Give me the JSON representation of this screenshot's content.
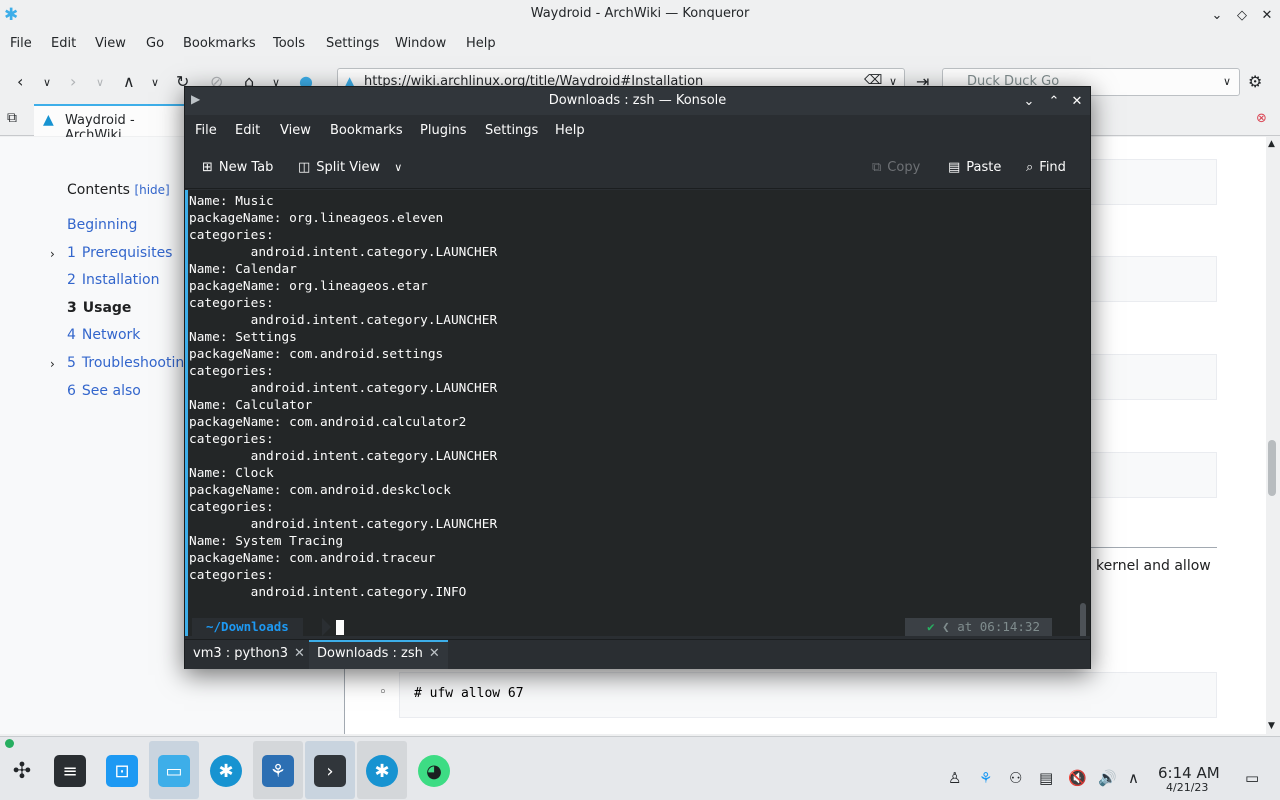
{
  "konqueror": {
    "title": "Waydroid - ArchWiki — Konqueror",
    "menu": [
      "File",
      "Edit",
      "View",
      "Go",
      "Bookmarks",
      "Tools",
      "Settings",
      "Window",
      "Help"
    ],
    "url": "https://wiki.archlinux.org/title/Waydroid#Installation",
    "search_placeholder": "Duck Duck Go",
    "tab_label": "Waydroid - ArchWiki"
  },
  "wiki": {
    "toc_title": "Contents",
    "toc_hide": "[hide]",
    "toc": [
      {
        "num": "",
        "label": "Beginning",
        "bold": false,
        "expandable": false
      },
      {
        "num": "1",
        "label": "Prerequisites",
        "bold": false,
        "expandable": true
      },
      {
        "num": "2",
        "label": "Installation",
        "bold": false,
        "expandable": false
      },
      {
        "num": "3",
        "label": "Usage",
        "bold": true,
        "expandable": false
      },
      {
        "num": "4",
        "label": "Network",
        "bold": false,
        "expandable": false
      },
      {
        "num": "5",
        "label": "Troubleshooting",
        "bold": false,
        "expandable": true
      },
      {
        "num": "6",
        "label": "See also",
        "bold": false,
        "expandable": false
      }
    ],
    "kernel_text": "kernel and allow",
    "bullet": "◦",
    "code_ufw": "# ufw allow 67"
  },
  "konsole": {
    "title": "Downloads : zsh — Konsole",
    "menu": [
      "File",
      "Edit",
      "View",
      "Bookmarks",
      "Plugins",
      "Settings",
      "Help"
    ],
    "toolbar": {
      "new_tab": "New Tab",
      "split_view": "Split View",
      "copy": "Copy",
      "paste": "Paste",
      "find": "Find"
    },
    "lines": [
      "Name: Music",
      "packageName: org.lineageos.eleven",
      "categories:",
      "        android.intent.category.LAUNCHER",
      "Name: Calendar",
      "packageName: org.lineageos.etar",
      "categories:",
      "        android.intent.category.LAUNCHER",
      "Name: Settings",
      "packageName: com.android.settings",
      "categories:",
      "        android.intent.category.LAUNCHER",
      "Name: Calculator",
      "packageName: com.android.calculator2",
      "categories:",
      "        android.intent.category.LAUNCHER",
      "Name: Clock",
      "packageName: com.android.deskclock",
      "categories:",
      "        android.intent.category.LAUNCHER",
      "Name: System Tracing",
      "packageName: com.android.traceur",
      "categories:",
      "        android.intent.category.INFO"
    ],
    "prompt_dir": "~/Downloads",
    "prompt_check": "✔",
    "prompt_time": "at 06:14:32",
    "tabs": [
      {
        "label": "vm3 : python3",
        "active": false
      },
      {
        "label": "Downloads : zsh",
        "active": true
      }
    ]
  },
  "taskbar": {
    "time": "6:14 AM",
    "date": "4/21/23"
  },
  "colors": {
    "accent": "#3daee9",
    "terminal_bg": "#232627",
    "link": "#3366cc"
  }
}
